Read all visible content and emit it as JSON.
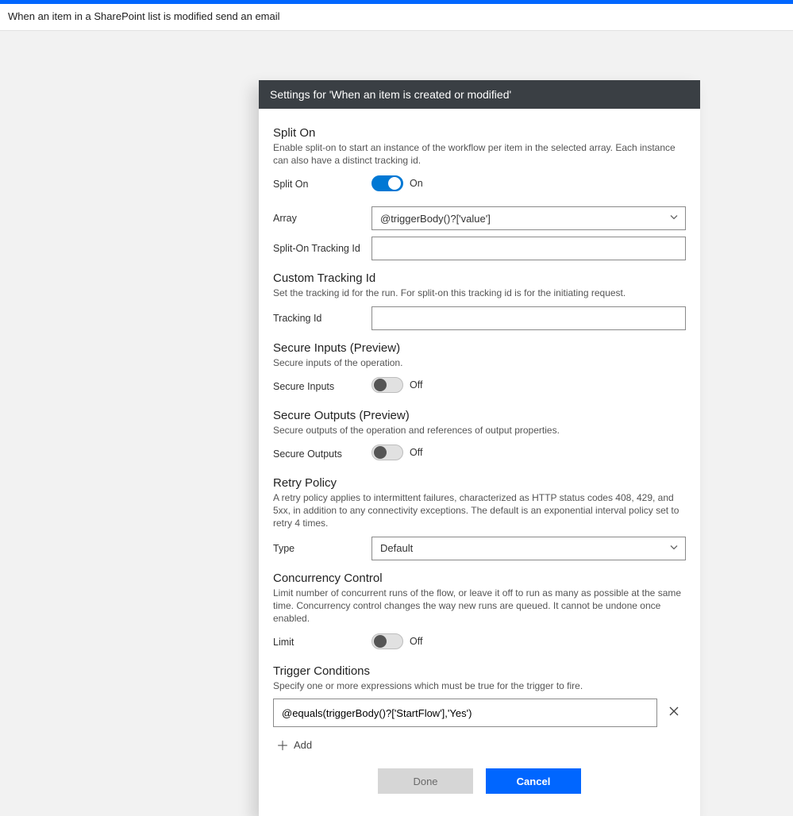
{
  "breadcrumb": "When an item in a SharePoint list is modified send an email",
  "panel": {
    "title": "Settings for 'When an item is created or modified'",
    "splitOn": {
      "title": "Split On",
      "desc": "Enable split-on to start an instance of the workflow per item in the selected array. Each instance can also have a distinct tracking id.",
      "toggleLabel": "Split On",
      "toggleState": "On",
      "arrayLabel": "Array",
      "arrayValue": "@triggerBody()?['value']",
      "trackingIdLabel": "Split-On Tracking Id",
      "trackingIdValue": ""
    },
    "customTracking": {
      "title": "Custom Tracking Id",
      "desc": "Set the tracking id for the run. For split-on this tracking id is for the initiating request.",
      "label": "Tracking Id",
      "value": ""
    },
    "secureInputs": {
      "title": "Secure Inputs (Preview)",
      "desc": "Secure inputs of the operation.",
      "label": "Secure Inputs",
      "state": "Off"
    },
    "secureOutputs": {
      "title": "Secure Outputs (Preview)",
      "desc": "Secure outputs of the operation and references of output properties.",
      "label": "Secure Outputs",
      "state": "Off"
    },
    "retryPolicy": {
      "title": "Retry Policy",
      "desc": "A retry policy applies to intermittent failures, characterized as HTTP status codes 408, 429, and 5xx, in addition to any connectivity exceptions. The default is an exponential interval policy set to retry 4 times.",
      "typeLabel": "Type",
      "typeValue": "Default"
    },
    "concurrency": {
      "title": "Concurrency Control",
      "desc": "Limit number of concurrent runs of the flow, or leave it off to run as many as possible at the same time. Concurrency control changes the way new runs are queued. It cannot be undone once enabled.",
      "label": "Limit",
      "state": "Off"
    },
    "triggerConditions": {
      "title": "Trigger Conditions",
      "desc": "Specify one or more expressions which must be true for the trigger to fire.",
      "conditions": [
        "@equals(triggerBody()?['StartFlow'],'Yes')"
      ],
      "addLabel": "Add"
    },
    "footer": {
      "done": "Done",
      "cancel": "Cancel"
    }
  }
}
